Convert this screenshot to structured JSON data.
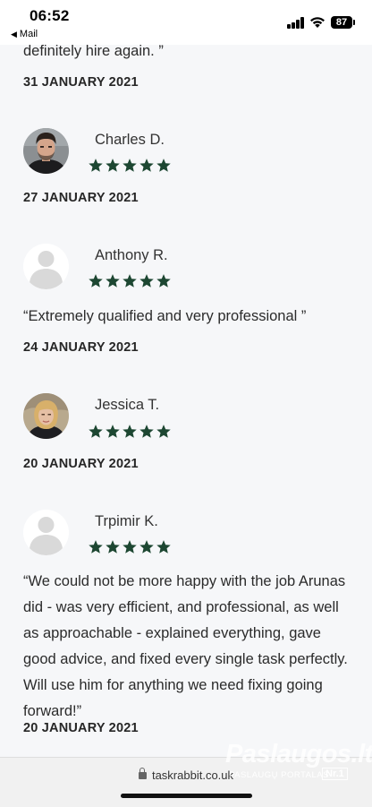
{
  "status_bar": {
    "time": "06:52",
    "back_label": "Mail",
    "battery": "87"
  },
  "reviews": [
    {
      "text": "definitely hire again. ”",
      "date": "31 JANUARY 2021"
    },
    {
      "name": "Charles D.",
      "rating": 5,
      "date": "27 JANUARY 2021",
      "avatar": "photo"
    },
    {
      "name": "Anthony R.",
      "rating": 5,
      "text": "“Extremely qualified and very professional ”",
      "date": "24 JANUARY 2021",
      "avatar": "placeholder"
    },
    {
      "name": "Jessica T.",
      "rating": 5,
      "date": "20 JANUARY 2021",
      "avatar": "photo"
    },
    {
      "name": "Trpimir K.",
      "rating": 5,
      "text": "“We could not be more happy with the job Arunas did - was very efficient, and professional, as well as approachable - explained everything, gave good advice, and fixed every single task perfectly. Will use him for anything we need fixing going forward!”",
      "date": "20 JANUARY 2021",
      "avatar": "placeholder"
    }
  ],
  "browser": {
    "url": "taskrabbit.co.uk"
  },
  "watermark": {
    "main": "Paslaugos.lt",
    "sub": "PASLAUGŲ PORTALAS",
    "badge": "Nr.1"
  },
  "colors": {
    "star": "#1d4732",
    "background": "#f6f7f9"
  }
}
